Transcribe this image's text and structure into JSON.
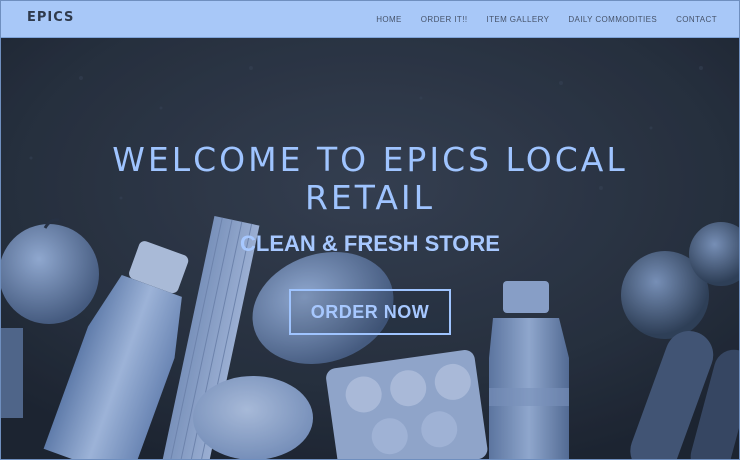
{
  "nav": {
    "brand": "EPICS",
    "links": [
      "HOME",
      "ORDER IT!!",
      "ITEM GALLERY",
      "DAILY COMMODITIES",
      "CONTACT"
    ]
  },
  "hero": {
    "title": "WELCOME TO EPICS LOCAL RETAIL",
    "subtitle": "CLEAN & FRESH STORE",
    "cta_label": "ORDER NOW",
    "image_description_icon": "groceries-photo"
  },
  "colors": {
    "navbar_bg": "#a8c8f8",
    "hero_text": "#9fc4ff",
    "hero_overlay": "#27303f"
  }
}
